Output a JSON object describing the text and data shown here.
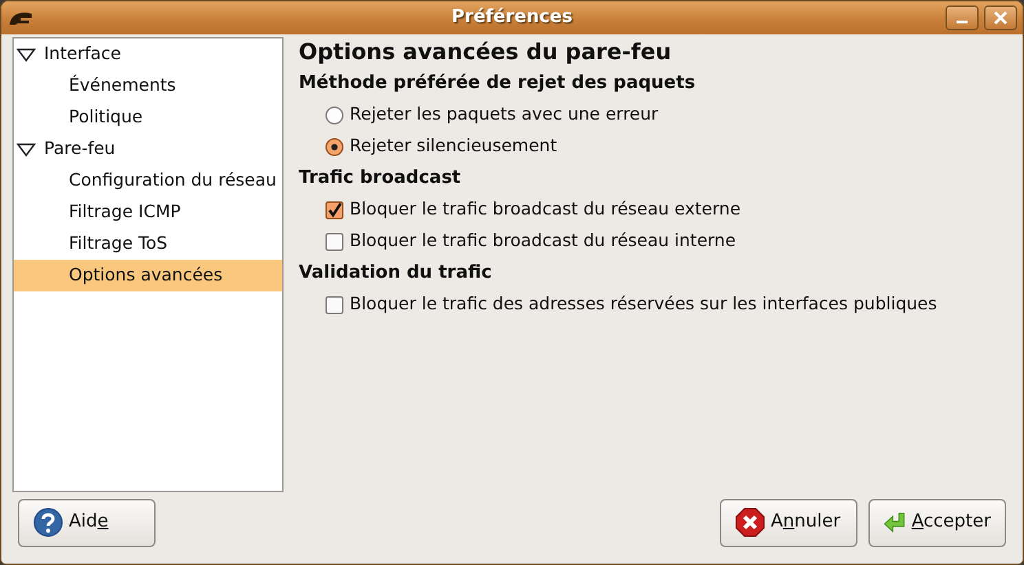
{
  "window": {
    "title": "Préférences"
  },
  "sidebar": {
    "items": [
      {
        "label": "Interface",
        "expanded": true,
        "selected": false,
        "children": [
          {
            "label": "Événements",
            "selected": false
          },
          {
            "label": "Politique",
            "selected": false
          }
        ]
      },
      {
        "label": "Pare-feu",
        "expanded": true,
        "selected": false,
        "children": [
          {
            "label": "Configuration du réseau",
            "selected": false
          },
          {
            "label": "Filtrage ICMP",
            "selected": false
          },
          {
            "label": "Filtrage ToS",
            "selected": false
          },
          {
            "label": "Options avancées",
            "selected": true
          }
        ]
      }
    ]
  },
  "page": {
    "title": "Options avancées du pare-feu",
    "sections": [
      {
        "heading": "Méthode préférée de rejet des paquets",
        "options": [
          {
            "kind": "radio",
            "label": "Rejeter les paquets avec une erreur",
            "checked": false
          },
          {
            "kind": "radio",
            "label": "Rejeter silencieusement",
            "checked": true
          }
        ]
      },
      {
        "heading": "Trafic broadcast",
        "options": [
          {
            "kind": "checkbox",
            "label": "Bloquer le trafic broadcast du réseau externe",
            "checked": true
          },
          {
            "kind": "checkbox",
            "label": "Bloquer le trafic broadcast du réseau interne",
            "checked": false
          }
        ]
      },
      {
        "heading": "Validation du trafic",
        "options": [
          {
            "kind": "checkbox",
            "label": "Bloquer le trafic des adresses réservées sur les interfaces publiques",
            "checked": false
          }
        ]
      }
    ]
  },
  "buttons": [
    {
      "kind": "help",
      "label_parts": [
        {
          "text": "Aid",
          "underlined": false
        },
        {
          "text": "e",
          "underlined": true
        }
      ]
    },
    {
      "kind": "cancel",
      "label_parts": [
        {
          "text": "A",
          "underlined": false
        },
        {
          "text": "n",
          "underlined": true
        },
        {
          "text": "nuler",
          "underlined": false
        }
      ]
    },
    {
      "kind": "accept",
      "label_parts": [
        {
          "text": "A",
          "underlined": true
        },
        {
          "text": "ccepter",
          "underlined": false
        }
      ]
    }
  ]
}
